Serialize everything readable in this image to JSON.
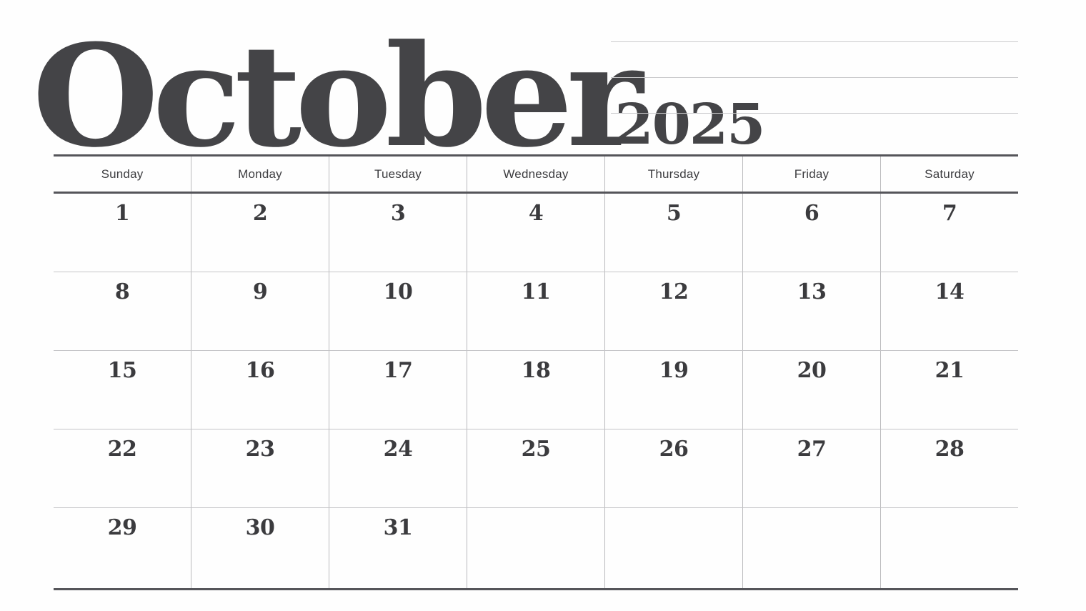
{
  "header": {
    "month": "October",
    "year": "2025",
    "note_lines": 3
  },
  "colors": {
    "ink": "#444447",
    "background": "#fefefe",
    "rule_heavy": "#55555a",
    "rule_light": "#c4c4c7",
    "column_divider": "#b9b9bc",
    "note_line": "#c9c9cb"
  },
  "calendar": {
    "weekdays": [
      "Sunday",
      "Monday",
      "Tuesday",
      "Wednesday",
      "Thursday",
      "Friday",
      "Saturday"
    ],
    "weeks": [
      [
        "1",
        "2",
        "3",
        "4",
        "5",
        "6",
        "7"
      ],
      [
        "8",
        "9",
        "10",
        "11",
        "12",
        "13",
        "14"
      ],
      [
        "15",
        "16",
        "17",
        "18",
        "19",
        "20",
        "21"
      ],
      [
        "22",
        "23",
        "24",
        "25",
        "26",
        "27",
        "28"
      ],
      [
        "29",
        "30",
        "31",
        "",
        "",
        "",
        ""
      ]
    ]
  }
}
